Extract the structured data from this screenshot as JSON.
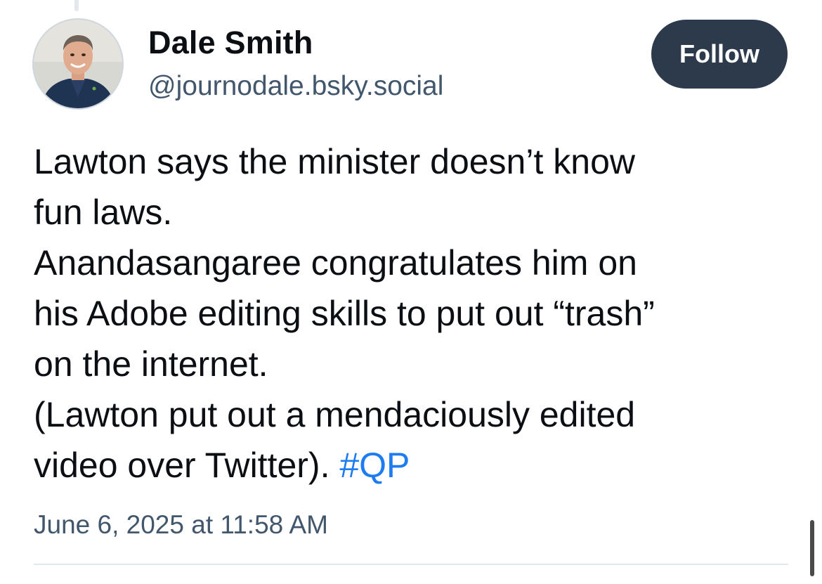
{
  "post": {
    "author": {
      "display_name": "Dale Smith",
      "handle": "@journodale.bsky.social",
      "avatar_icon": "profile-photo"
    },
    "follow_label": "Follow",
    "text_lines": [
      "Lawton says the minister doesn’t know",
      "fun laws.",
      "Anandasangaree congratulates him on",
      "his Adobe editing skills to put out “trash”",
      "on the internet.",
      "(Lawton put out a mendaciously edited"
    ],
    "last_line_text": "video over Twitter). ",
    "hashtag": "#QP",
    "timestamp": "June 6, 2025 at 11:58 AM"
  },
  "colors": {
    "follow_button_bg": "#2c3a4b",
    "hashtag": "#1d7cf2",
    "secondary_text": "#42576c",
    "divider": "#e3e8ee"
  }
}
